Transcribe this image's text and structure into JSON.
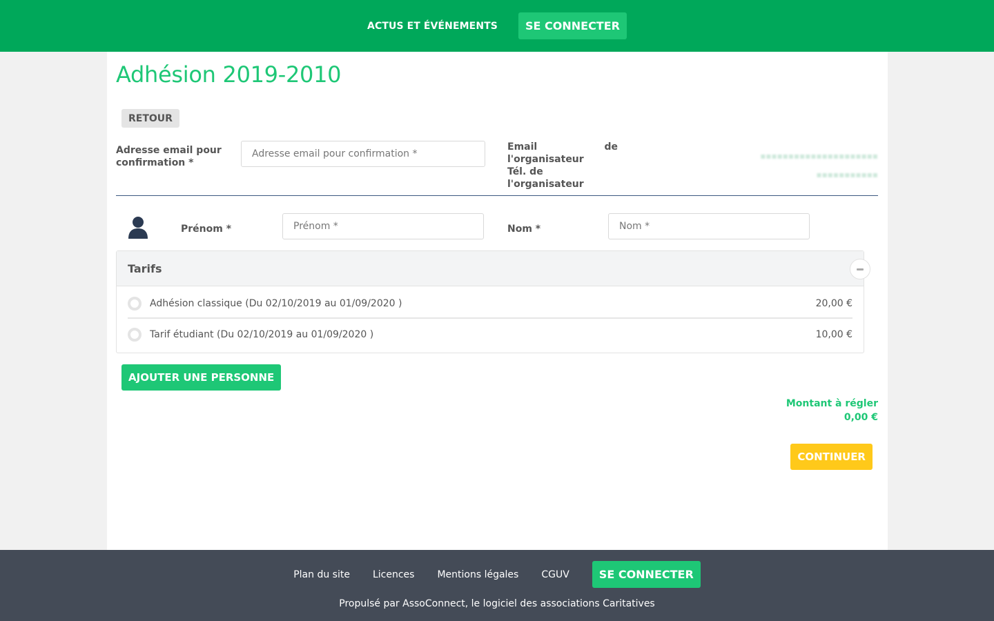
{
  "header": {
    "nav_news": "ACTUS ET ÉVÉNEMENTS",
    "connect": "SE CONNECTER"
  },
  "page": {
    "title": "Adhésion 2019-2010",
    "back": "RETOUR"
  },
  "confirm_email": {
    "label": "Adresse email pour confirmation *",
    "placeholder": "Adresse email pour confirmation *"
  },
  "organizer": {
    "email_label_1": "Email",
    "email_label_2": "de",
    "email_label_3": "l'organisateur",
    "phone_label": "Tél. de l'organisateur"
  },
  "person": {
    "first_name_label": "Prénom *",
    "first_name_placeholder": "Prénom *",
    "last_name_label": "Nom *",
    "last_name_placeholder": "Nom *"
  },
  "tarifs": {
    "title": "Tarifs",
    "items": [
      {
        "label": "Adhésion classique (Du 02/10/2019 au 01/09/2020 )",
        "price": "20,00 €"
      },
      {
        "label": "Tarif étudiant (Du 02/10/2019 au 01/09/2020 )",
        "price": "10,00 €"
      }
    ]
  },
  "actions": {
    "add_person": "AJOUTER UNE PERSONNE",
    "amount_label": "Montant à régler",
    "amount_value": "0,00 €",
    "continue": "CONTINUER"
  },
  "footer": {
    "links": [
      "Plan du site",
      "Licences",
      "Mentions légales",
      "CGUV"
    ],
    "connect": "SE CONNECTER",
    "note": "Propulsé par AssoConnect, le logiciel des associations Caritatives"
  },
  "colors": {
    "header_bg": "#00a85a",
    "accent": "#1ec776",
    "continue": "#ffc91a",
    "footer_bg": "#444b57"
  }
}
